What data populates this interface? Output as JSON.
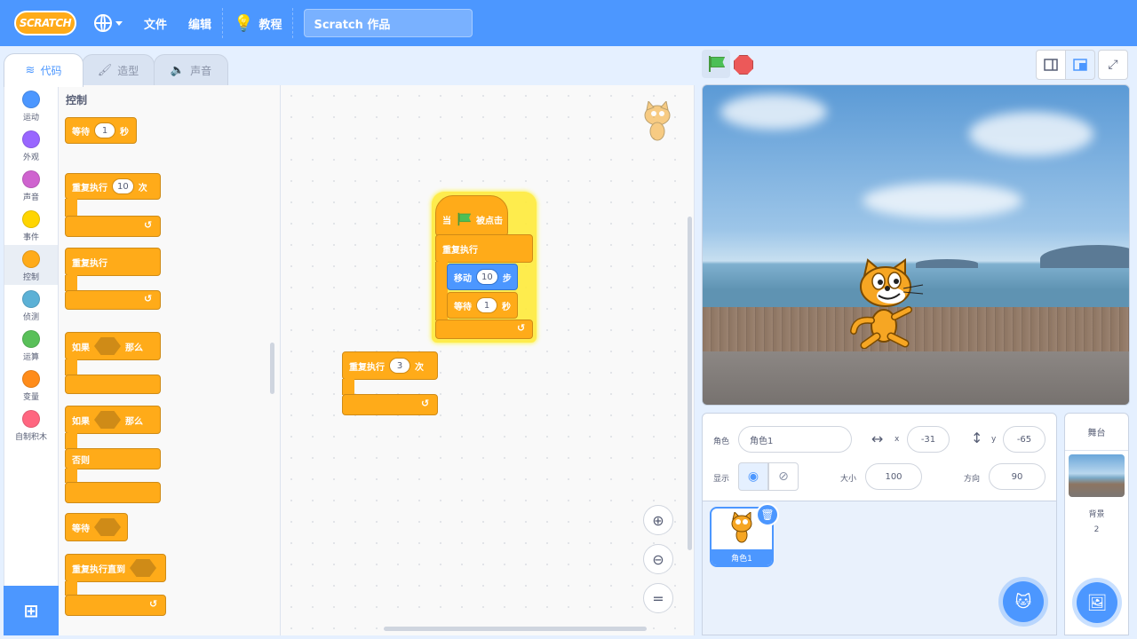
{
  "menubar": {
    "logo": "SCRATCH",
    "file": "文件",
    "edit": "编辑",
    "tutorials": "教程",
    "project_title": "Scratch 作品"
  },
  "tabs": {
    "code": "代码",
    "costumes": "造型",
    "sounds": "声音"
  },
  "categories": [
    {
      "label": "运动",
      "color": "#4c97ff"
    },
    {
      "label": "外观",
      "color": "#9966ff"
    },
    {
      "label": "声音",
      "color": "#cf63cf"
    },
    {
      "label": "事件",
      "color": "#ffd500"
    },
    {
      "label": "控制",
      "color": "#ffab19"
    },
    {
      "label": "侦测",
      "color": "#5cb1d6"
    },
    {
      "label": "运算",
      "color": "#59c059"
    },
    {
      "label": "变量",
      "color": "#ff8c1a"
    },
    {
      "label": "自制积木",
      "color": "#ff6680"
    }
  ],
  "flyout": {
    "title": "控制",
    "wait_label": "等待",
    "wait_value": "1",
    "wait_unit": "秒",
    "repeat_label": "重复执行",
    "repeat_value": "10",
    "repeat_unit": "次",
    "forever_label": "重复执行",
    "if_label": "如果",
    "then_label": "那么",
    "if2_label": "如果",
    "then2_label": "那么",
    "else_label": "否则",
    "wait_until_label": "等待",
    "repeat_until_label": "重复执行直到"
  },
  "script": {
    "when_label": "当",
    "clicked_label": "被点击",
    "forever_label": "重复执行",
    "move_label": "移动",
    "move_value": "10",
    "move_unit": "步",
    "wait_label": "等待",
    "wait_value": "1",
    "wait_unit": "秒"
  },
  "loose_block": {
    "label": "重复执行",
    "value": "3",
    "unit": "次"
  },
  "sprite": {
    "sprite_label": "角色",
    "name": "角色1",
    "x_label": "x",
    "x": "-31",
    "y_label": "y",
    "y": "-65",
    "show_label": "显示",
    "size_label": "大小",
    "size": "100",
    "direction_label": "方向",
    "direction": "90",
    "tile_name": "角色1"
  },
  "stage_pane": {
    "title": "舞台",
    "backdrop_label": "背景",
    "backdrop_count": "2"
  },
  "colors": {
    "primary": "#4c97ff",
    "control": "#ffab19",
    "motion": "#4c97ff"
  }
}
